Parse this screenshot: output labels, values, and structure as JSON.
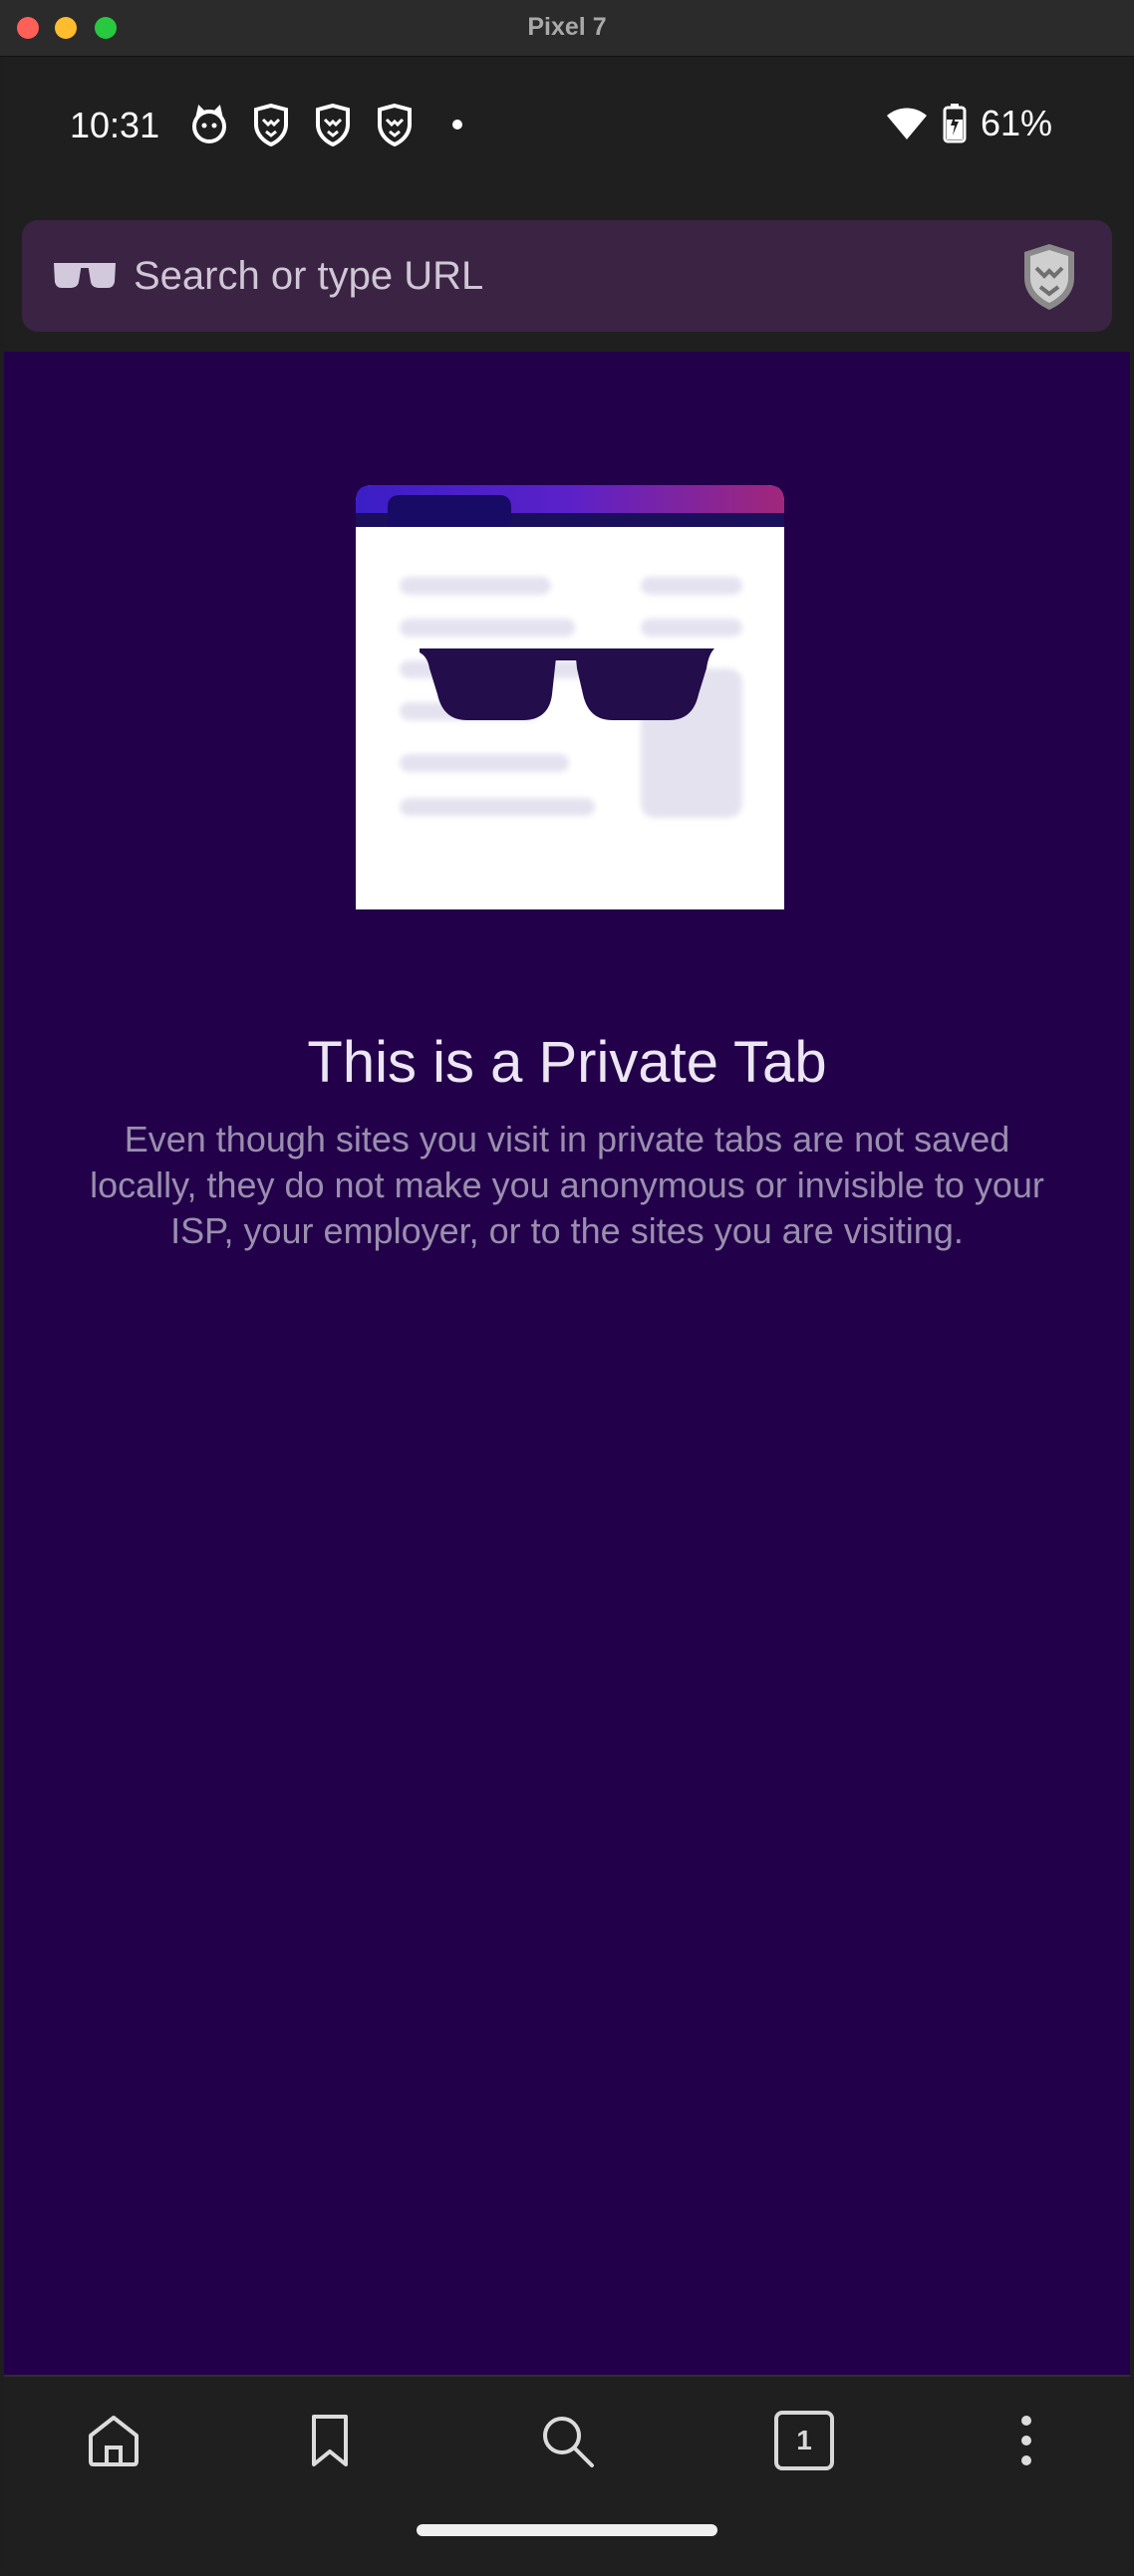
{
  "window": {
    "title": "Pixel 7"
  },
  "status_bar": {
    "time": "10:31",
    "battery_percent": "61%"
  },
  "url_bar": {
    "placeholder": "Search or type URL"
  },
  "private_tab": {
    "title": "This is a Private Tab",
    "description": "Even though sites you visit in private tabs are not saved locally, they do not make you anonymous or invisible to your ISP, your employer, or to the sites you are visiting."
  },
  "toolbar": {
    "tab_count": "1",
    "buttons": [
      "home-icon",
      "bookmark-icon",
      "search-icon",
      "tab-switcher",
      "more-icon"
    ]
  },
  "colors": {
    "private_background": "#22014a",
    "url_bar": "#3b2343",
    "chrome": "#1f1f1f",
    "text_secondary": "#9a8fae"
  }
}
